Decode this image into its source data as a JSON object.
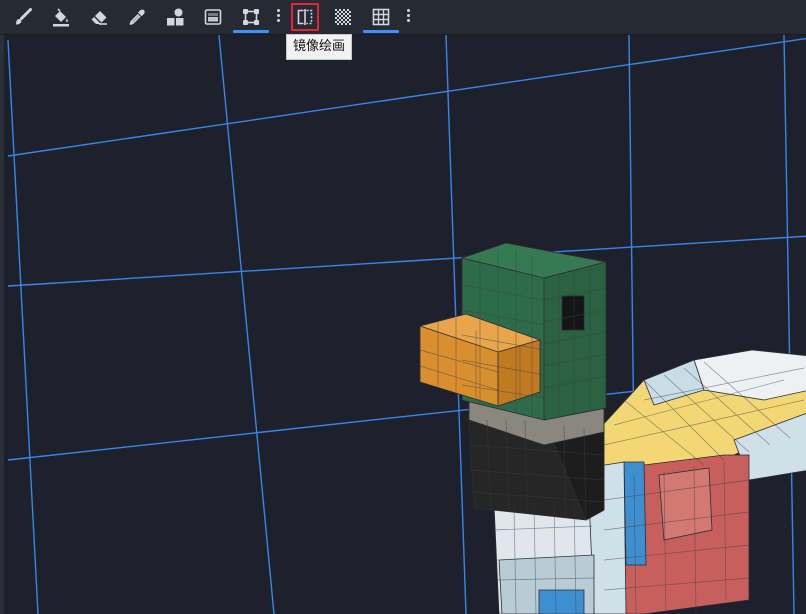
{
  "colors": {
    "accent": "#3e90ff",
    "hover_outline": "#e0262e",
    "viewport_background": "#1e212b",
    "toolbar_background": "#262a33",
    "icon": "#d4d6dc"
  },
  "toolbar": {
    "tools": [
      {
        "id": "brush",
        "icon": "brush-icon"
      },
      {
        "id": "fill",
        "icon": "paint-bucket-icon"
      },
      {
        "id": "eraser",
        "icon": "eraser-icon"
      },
      {
        "id": "color-picker",
        "icon": "eyedropper-icon"
      },
      {
        "id": "shapes",
        "icon": "shapes-icon"
      },
      {
        "id": "gradient",
        "icon": "gradient-icon"
      },
      {
        "id": "transform",
        "icon": "transform-icon",
        "selected": true
      },
      {
        "id": "mirror-painting",
        "icon": "mirror-icon",
        "hovered": true
      },
      {
        "id": "lock-alpha",
        "icon": "checkerboard-icon"
      },
      {
        "id": "grid",
        "icon": "grid-icon",
        "selected": true
      }
    ]
  },
  "tooltip": {
    "text": "镜像绘画"
  },
  "viewport": {
    "model": "duck",
    "model_colors": {
      "head_green": "#2e6b48",
      "beak_orange": "#d98f2e",
      "neck_gray": "#8a877f",
      "chest_black": "#262626",
      "body_light": "#dfe7ec",
      "wing_yellow": "#f3d774",
      "side_red": "#c7605c",
      "blue_accent": "#3e8fd0",
      "grid_line": "#3e90ff"
    }
  }
}
